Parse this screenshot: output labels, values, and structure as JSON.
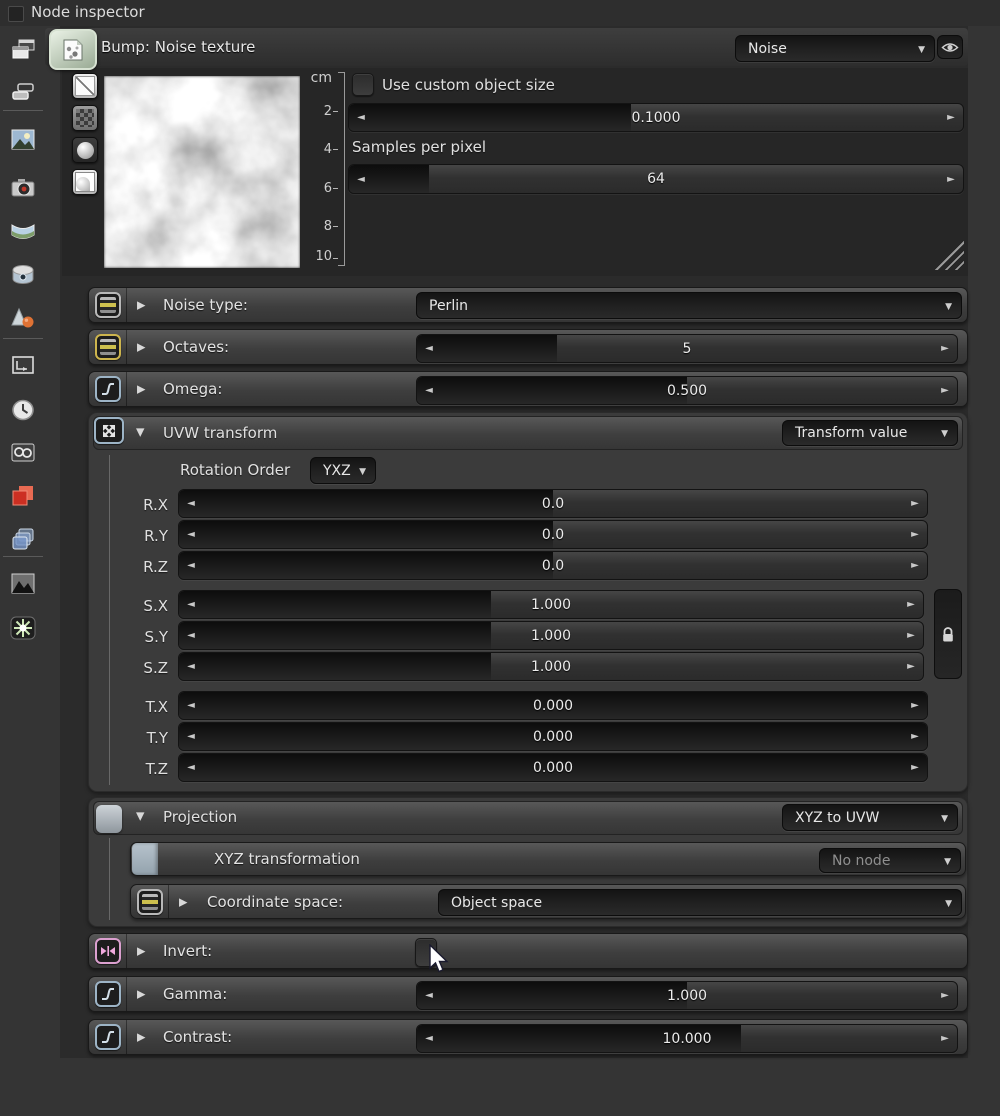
{
  "window": {
    "title": "Node inspector"
  },
  "header": {
    "title": "Bump: Noise texture",
    "type_dropdown": "Noise"
  },
  "glyphs": {
    "tri_right": "▶",
    "tri_down": "▼",
    "caret": "▼",
    "arrow_left": "◄",
    "arrow_right": "►"
  },
  "sidebar": {
    "icons": [
      "cascade-windows",
      "flat-stack",
      "image",
      "camera",
      "panorama-strip",
      "cylinder-texture",
      "geometry",
      "dimensions",
      "clock",
      "procedural-gears",
      "red-cube",
      "layer-stack",
      "dark-image",
      "starburst"
    ]
  },
  "preview": {
    "ruler": {
      "unit": "cm",
      "ticks": [
        "2",
        "4",
        "6",
        "8",
        "10"
      ]
    },
    "custom_size": {
      "label": "Use custom object size",
      "value": "0.1000",
      "fill_pct": 46
    },
    "samples": {
      "label": "Samples per pixel",
      "value": "64",
      "fill_pct": 13
    }
  },
  "params": {
    "noise_type": {
      "label": "Noise type:",
      "value": "Perlin"
    },
    "octaves": {
      "label": "Octaves:",
      "value": "5",
      "fill_pct": 26
    },
    "omega": {
      "label": "Omega:",
      "value": "0.500",
      "fill_pct": 50
    },
    "uvw": {
      "title": "UVW transform",
      "mode": "Transform value",
      "rotation_order_label": "Rotation Order",
      "rotation_order": "YXZ",
      "rx": {
        "label": "R.X",
        "value": "0.0",
        "fill_pct": 50
      },
      "ry": {
        "label": "R.Y",
        "value": "0.0",
        "fill_pct": 50
      },
      "rz": {
        "label": "R.Z",
        "value": "0.0",
        "fill_pct": 50
      },
      "sx": {
        "label": "S.X",
        "value": "1.000",
        "fill_pct": 42
      },
      "sy": {
        "label": "S.Y",
        "value": "1.000",
        "fill_pct": 42
      },
      "sz": {
        "label": "S.Z",
        "value": "1.000",
        "fill_pct": 42
      },
      "tx": {
        "label": "T.X",
        "value": "0.000",
        "fill_pct": 100
      },
      "ty": {
        "label": "T.Y",
        "value": "0.000",
        "fill_pct": 100
      },
      "tz": {
        "label": "T.Z",
        "value": "0.000",
        "fill_pct": 100
      }
    },
    "projection": {
      "title": "Projection",
      "mode": "XYZ to UVW",
      "xyz_label": "XYZ transformation",
      "xyz_value": "No node",
      "coord_label": "Coordinate space:",
      "coord_value": "Object space"
    },
    "invert": {
      "label": "Invert:"
    },
    "gamma": {
      "label": "Gamma:",
      "value": "1.000",
      "fill_pct": 50
    },
    "contrast": {
      "label": "Contrast:",
      "value": "10.000",
      "fill_pct": 60
    }
  }
}
